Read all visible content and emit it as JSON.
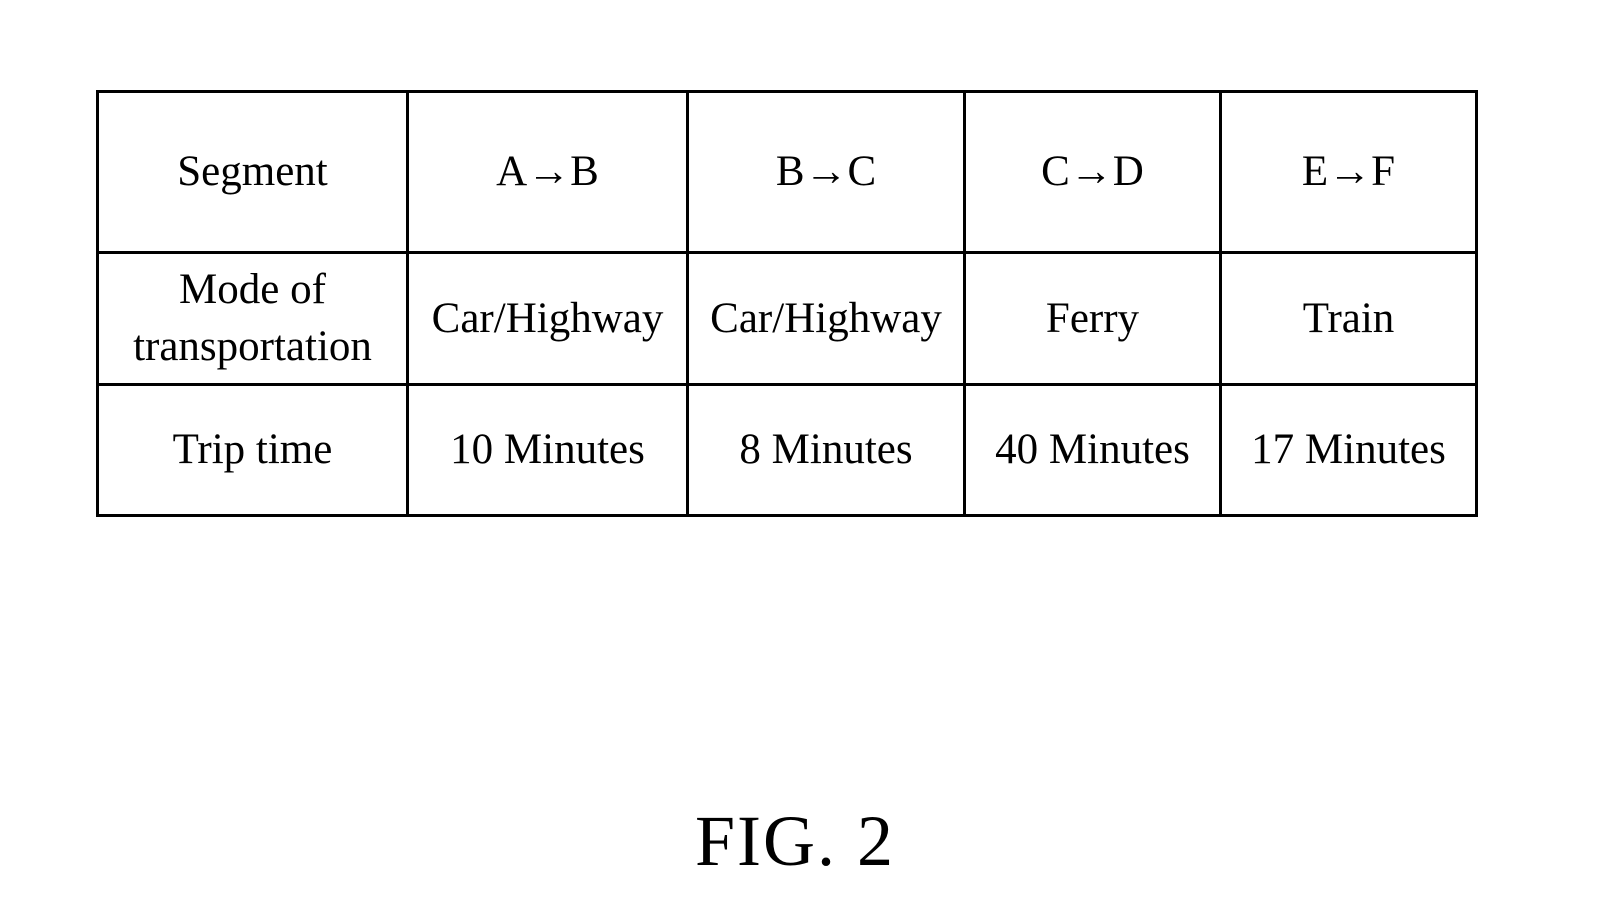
{
  "table": {
    "rows": [
      {
        "header": "Segment",
        "cells": [
          "A→B",
          "B→C",
          "C→D",
          "E→F"
        ]
      },
      {
        "header": "Mode of transportation",
        "cells": [
          "Car/Highway",
          "Car/Highway",
          "Ferry",
          "Train"
        ]
      },
      {
        "header": "Trip time",
        "cells": [
          "10 Minutes",
          "8 Minutes",
          "40 Minutes",
          "17 Minutes"
        ]
      }
    ]
  },
  "caption": "FIG. 2"
}
